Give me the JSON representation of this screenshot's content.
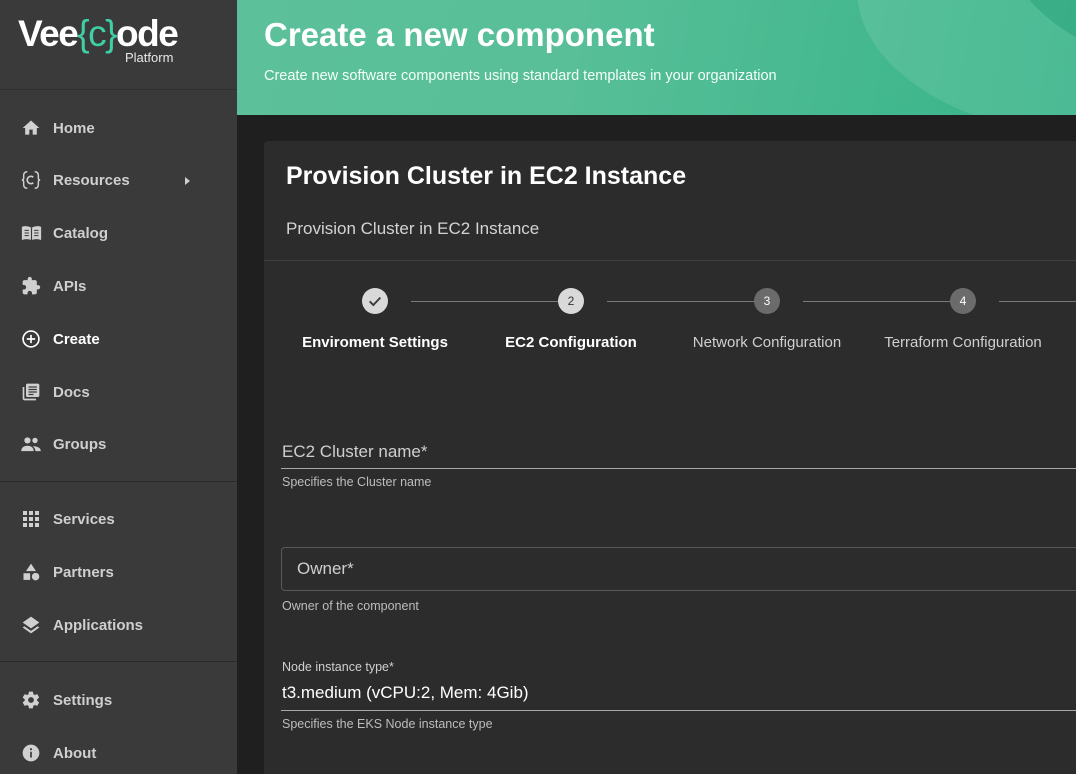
{
  "logo": {
    "pre": "Vee",
    "brace_open": "{",
    "mid": "c",
    "brace_close": "}",
    "post": "ode",
    "sub": "Platform",
    "accent": "#3ecfa6"
  },
  "sidebar": {
    "items": [
      {
        "label": "Home",
        "icon": "home-icon"
      },
      {
        "label": "Resources",
        "icon": "resources-icon"
      },
      {
        "label": "Catalog",
        "icon": "catalog-icon"
      },
      {
        "label": "APIs",
        "icon": "puzzle-icon"
      },
      {
        "label": "Create",
        "icon": "plus-circle-icon",
        "active": true
      },
      {
        "label": "Docs",
        "icon": "docs-icon"
      },
      {
        "label": "Groups",
        "icon": "groups-icon"
      },
      {
        "label": "Services",
        "icon": "grid-icon"
      },
      {
        "label": "Partners",
        "icon": "shapes-icon"
      },
      {
        "label": "Applications",
        "icon": "layers-icon"
      },
      {
        "label": "Settings",
        "icon": "gear-icon"
      },
      {
        "label": "About",
        "icon": "info-icon"
      }
    ]
  },
  "header": {
    "title": "Create a new component",
    "subtitle": "Create new software components using standard templates in your organization",
    "color": "#4fbd95"
  },
  "card": {
    "title": "Provision Cluster in EC2 Instance",
    "subtitle": "Provision Cluster in EC2 Instance"
  },
  "stepper": {
    "steps": [
      {
        "number": "",
        "label": "Enviroment Settings",
        "state": "done"
      },
      {
        "number": "2",
        "label": "EC2 Configuration",
        "state": "active"
      },
      {
        "number": "3",
        "label": "Network Configuration",
        "state": "pending"
      },
      {
        "number": "4",
        "label": "Terraform Configuration",
        "state": "pending"
      }
    ]
  },
  "form": {
    "cluster_name": {
      "label": "EC2 Cluster name*",
      "helper": "Specifies the Cluster name",
      "value": ""
    },
    "owner": {
      "label": "Owner*",
      "helper": "Owner of the component",
      "value": ""
    },
    "node_type": {
      "label": "Node instance type*",
      "value": "t3.medium (vCPU:2, Mem: 4Gib)",
      "helper": "Specifies the EKS Node instance type"
    }
  }
}
